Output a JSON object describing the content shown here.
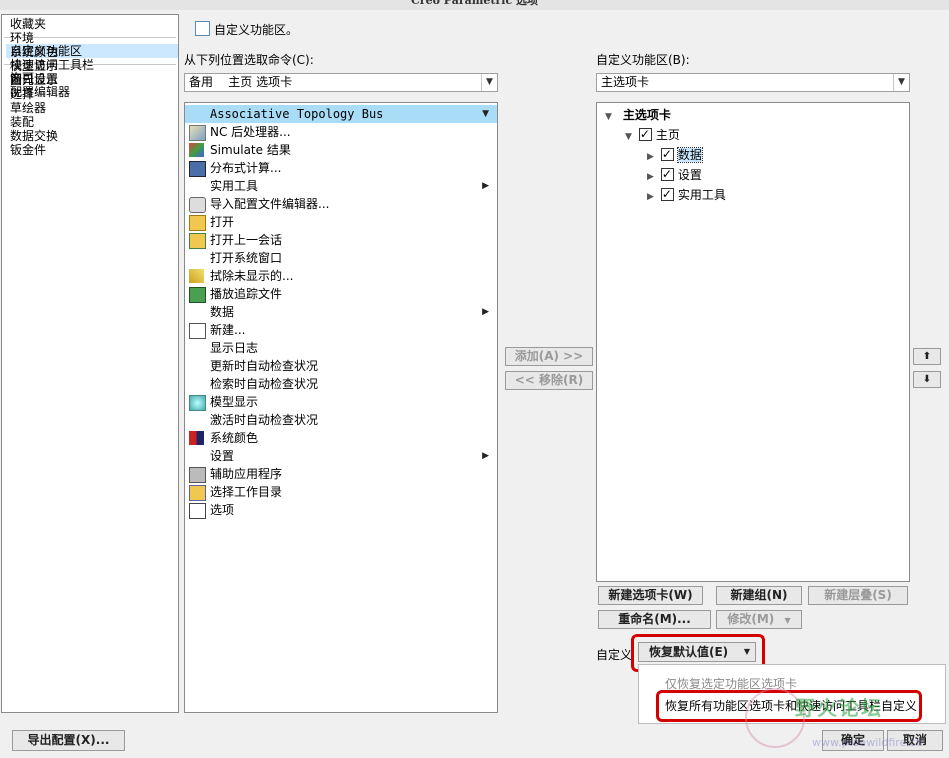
{
  "window": {
    "title": "Creo Parametric 选项"
  },
  "nav": {
    "group1": [
      "收藏夹",
      "环境",
      "系统颜色",
      "模型显示",
      "图元显示",
      "选择",
      "草绘器",
      "装配",
      "数据交换",
      "钣金件"
    ],
    "group2": [
      "自定义功能区",
      "快速访问工具栏",
      "窗口设置"
    ],
    "group3": [
      "许可",
      "配置编辑器"
    ],
    "selected": "自定义功能区"
  },
  "header": {
    "checkbox_label": "自定义功能区。"
  },
  "left_col": {
    "label": "从下列位置选取命令(C):",
    "combo_value": "备用    主页 选项卡",
    "commands": [
      {
        "label": "Associative Topology Bus",
        "icon": "none",
        "submenu": false,
        "highlight": true,
        "mono": true
      },
      {
        "label": "NC 后处理器...",
        "icon": "nc-post-icon",
        "submenu": false
      },
      {
        "label": "Simulate 结果",
        "icon": "simulate-icon",
        "submenu": false
      },
      {
        "label": "分布式计算...",
        "icon": "distributed-icon",
        "submenu": false
      },
      {
        "label": "实用工具",
        "icon": "none",
        "submenu": true
      },
      {
        "label": "导入配置文件编辑器...",
        "icon": "import-config-icon",
        "submenu": false
      },
      {
        "label": "打开",
        "icon": "open-folder-icon",
        "submenu": false
      },
      {
        "label": "打开上一会话",
        "icon": "open-session-icon",
        "submenu": false
      },
      {
        "label": "打开系统窗口",
        "icon": "none",
        "submenu": false
      },
      {
        "label": "拭除未显示的...",
        "icon": "erase-icon",
        "submenu": false
      },
      {
        "label": "播放追踪文件",
        "icon": "play-trail-icon",
        "submenu": false
      },
      {
        "label": "数据",
        "icon": "none",
        "submenu": true
      },
      {
        "label": "新建...",
        "icon": "new-file-icon",
        "submenu": false
      },
      {
        "label": "显示日志",
        "icon": "none",
        "submenu": false
      },
      {
        "label": "更新时自动检查状况",
        "icon": "none",
        "submenu": false
      },
      {
        "label": "检索时自动检查状况",
        "icon": "none",
        "submenu": false
      },
      {
        "label": "模型显示",
        "icon": "model-display-icon",
        "submenu": false
      },
      {
        "label": "激活时自动检查状况",
        "icon": "none",
        "submenu": false
      },
      {
        "label": "系统颜色",
        "icon": "system-color-icon",
        "submenu": false
      },
      {
        "label": "设置",
        "icon": "none",
        "submenu": true
      },
      {
        "label": "辅助应用程序",
        "icon": "aux-app-icon",
        "submenu": false
      },
      {
        "label": "选择工作目录",
        "icon": "work-dir-icon",
        "submenu": false
      },
      {
        "label": "选项",
        "icon": "options-icon",
        "submenu": false
      }
    ]
  },
  "middle": {
    "add_label": "添加(A) >>",
    "remove_label": "<< 移除(R)"
  },
  "right_col": {
    "label": "自定义功能区(B):",
    "combo_value": "主选项卡",
    "tree": {
      "root": "主选项卡",
      "home": "主页",
      "children": [
        "数据",
        "设置",
        "实用工具"
      ]
    },
    "new_tab": "新建选项卡(W)",
    "new_group": "新建组(N)",
    "new_cascade": "新建层叠(S)",
    "rename": "重命名(M)...",
    "modify": "修改(M)",
    "customize_label": "自定义",
    "restore_default": "恢复默认值(E)"
  },
  "dropdown": {
    "option1": "仅恢复选定功能区选项卡",
    "option2": "恢复所有功能区选项卡和快速访问工具栏自定义"
  },
  "footer": {
    "export": "导出配置(X)...",
    "ok": "确定",
    "cancel": "取消",
    "watermark": "野火论坛",
    "watermark_url": "www.proewildfire.cn"
  },
  "colors": {
    "selection": "#cce8ff",
    "highlight": "#a8dcf7",
    "annotation_red": "#d40000"
  }
}
